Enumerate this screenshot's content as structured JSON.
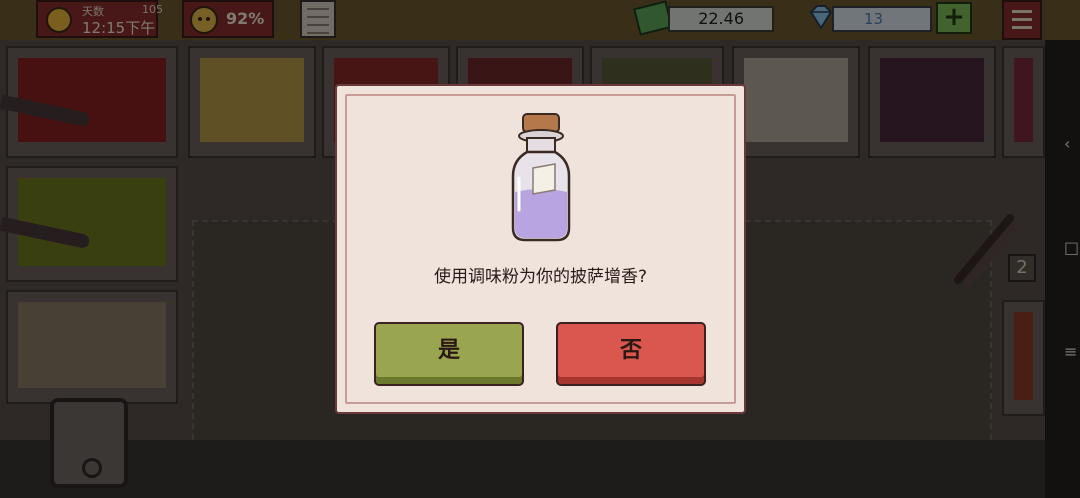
{
  "hud": {
    "day_label": "天数",
    "day_number": "105",
    "clock": "12:15下午",
    "mood_percent": "92%",
    "money": "22.46",
    "gems": "13",
    "add_gems_label": "+"
  },
  "kitchen": {
    "tongs_count": "2"
  },
  "dialog": {
    "prompt": "使用调味粉为你的披萨增香?",
    "yes_label": "是",
    "no_label": "否"
  },
  "colors": {
    "yes_button": "#9aa550",
    "no_button": "#d9574f",
    "dialog_bg": "#efe3dc",
    "hud_box": "#8b2f2f"
  }
}
